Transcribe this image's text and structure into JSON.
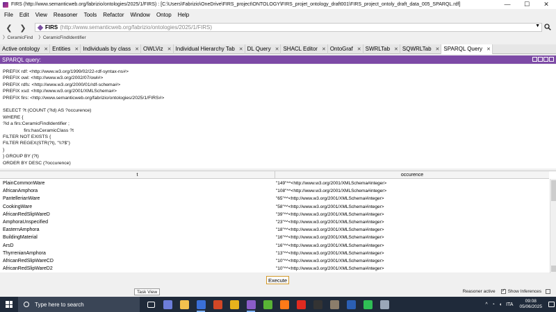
{
  "window": {
    "title": "FIRS (http://www.semanticweb.org/fabrizio/ontologies/2025/1/FIRS) : [C:\\Users\\Fabrizio\\OneDrive\\FIRS_project\\ONTOLOGY\\FIRS_projet_ontology_draft001\\FIRS_project_ontoly_draft_data_005_SPARQL.rdf]",
    "controls": [
      "—",
      "☐",
      "✕"
    ]
  },
  "menu": [
    "File",
    "Edit",
    "View",
    "Reasoner",
    "Tools",
    "Refactor",
    "Window",
    "Ontop",
    "Help"
  ],
  "address": {
    "name": "FIRS",
    "url": "(http://www.semanticweb.org/fabrizio/ontologies/2025/1/FIRS)"
  },
  "breadcrumb": [
    "CeramicFind",
    "CeramicFindIdentifier"
  ],
  "tabs": [
    {
      "label": "Active ontology",
      "active": false
    },
    {
      "label": "Entities",
      "active": false
    },
    {
      "label": "Individuals by class",
      "active": false
    },
    {
      "label": "OWLViz",
      "active": false
    },
    {
      "label": "Individual Hierarchy Tab",
      "active": false
    },
    {
      "label": "DL Query",
      "active": false
    },
    {
      "label": "SHACL Editor",
      "active": false
    },
    {
      "label": "OntoGraf",
      "active": false
    },
    {
      "label": "SWRLTab",
      "active": false
    },
    {
      "label": "SQWRLTab",
      "active": false
    },
    {
      "label": "SPARQL Query",
      "active": true
    }
  ],
  "view": {
    "title": "SPARQL query:"
  },
  "query_lines": [
    "PREFIX rdf: <http://www.w3.org/1999/02/22-rdf-syntax-ns#>",
    "PREFIX owl: <http://www.w3.org/2002/07/owl#>",
    "PREFIX rdfs: <http://www.w3.org/2000/01/rdf-schema#>",
    "PREFIX xsd: <http://www.w3.org/2001/XMLSchema#>",
    "PREFIX firs: <http://www.semanticweb.org/fabrizio/ontologies/2025/1/FIRS#>",
    "",
    "SELECT ?t (COUNT (?id) AS ?occurence)",
    "WHERE {",
    "?id a firs:CeramicFindIdentifier ;",
    "                firs:hasCeramicClass ?t",
    "FILTER NOT EXISTS {",
    "FILTER REGEX(STR(?t), \"\\\\?$\")",
    "}",
    "} GROUP BY (?t)",
    "ORDER BY DESC (?occurence)"
  ],
  "results": {
    "columns": [
      "t",
      "occurence"
    ],
    "rows": [
      [
        "PlainCommonWare",
        "\"149\"^^<http://www.w3.org/2001/XMLSchema#integer>"
      ],
      [
        "AfricanAmphora",
        "\"108\"^^<http://www.w3.org/2001/XMLSchema#integer>"
      ],
      [
        "PantellerianWare",
        "\"65\"^^<http://www.w3.org/2001/XMLSchema#integer>"
      ],
      [
        "CookingWare",
        "\"58\"^^<http://www.w3.org/2001/XMLSchema#integer>"
      ],
      [
        "AfricanRedSlipWareD",
        "\"39\"^^<http://www.w3.org/2001/XMLSchema#integer>"
      ],
      [
        "AmphoraUnspecified",
        "\"23\"^^<http://www.w3.org/2001/XMLSchema#integer>"
      ],
      [
        "EasternAmphora",
        "\"18\"^^<http://www.w3.org/2001/XMLSchema#integer>"
      ],
      [
        "BuildingMaterial",
        "\"16\"^^<http://www.w3.org/2001/XMLSchema#integer>"
      ],
      [
        "ArsD",
        "\"16\"^^<http://www.w3.org/2001/XMLSchema#integer>"
      ],
      [
        "ThyrrenianAmphora",
        "\"13\"^^<http://www.w3.org/2001/XMLSchema#integer>"
      ],
      [
        "AfricanRedSlipWareCD",
        "\"10\"^^<http://www.w3.org/2001/XMLSchema#integer>"
      ],
      [
        "AfricanRedSlipWareD2",
        "\"10\"^^<http://www.w3.org/2001/XMLSchema#integer>"
      ]
    ]
  },
  "execute_label": "Execute",
  "tooltip": "Task View",
  "status": {
    "reasoner": "Reasoner active",
    "show_inferences": "Show Inferences"
  },
  "taskbar": {
    "search_placeholder": "Type here to search",
    "time": "09:08",
    "date": "05/06/2025",
    "lang": "ITA",
    "apps": [
      {
        "name": "task-view-icon",
        "color": "#ffffff"
      },
      {
        "name": "widgets-icon",
        "color": "#6c7dd9"
      },
      {
        "name": "file-explorer-icon",
        "color": "#f2c14e"
      },
      {
        "name": "protege-icon",
        "color": "#3a6fd8"
      },
      {
        "name": "powerpoint-icon",
        "color": "#d24726"
      },
      {
        "name": "chrome-icon",
        "color": "#e8b21c"
      },
      {
        "name": "vs-icon",
        "color": "#8a5cc7"
      },
      {
        "name": "qgis-icon",
        "color": "#58b335"
      },
      {
        "name": "firefox-icon",
        "color": "#ff7a18"
      },
      {
        "name": "acrobat-icon",
        "color": "#e02a20"
      },
      {
        "name": "inkscape-icon",
        "color": "#333333"
      },
      {
        "name": "gimp-icon",
        "color": "#8b7d6b"
      },
      {
        "name": "word-icon",
        "color": "#2b5fb4"
      },
      {
        "name": "whatsapp-icon",
        "color": "#2fbe55"
      },
      {
        "name": "app-icon",
        "color": "#9aa7b8"
      }
    ]
  }
}
